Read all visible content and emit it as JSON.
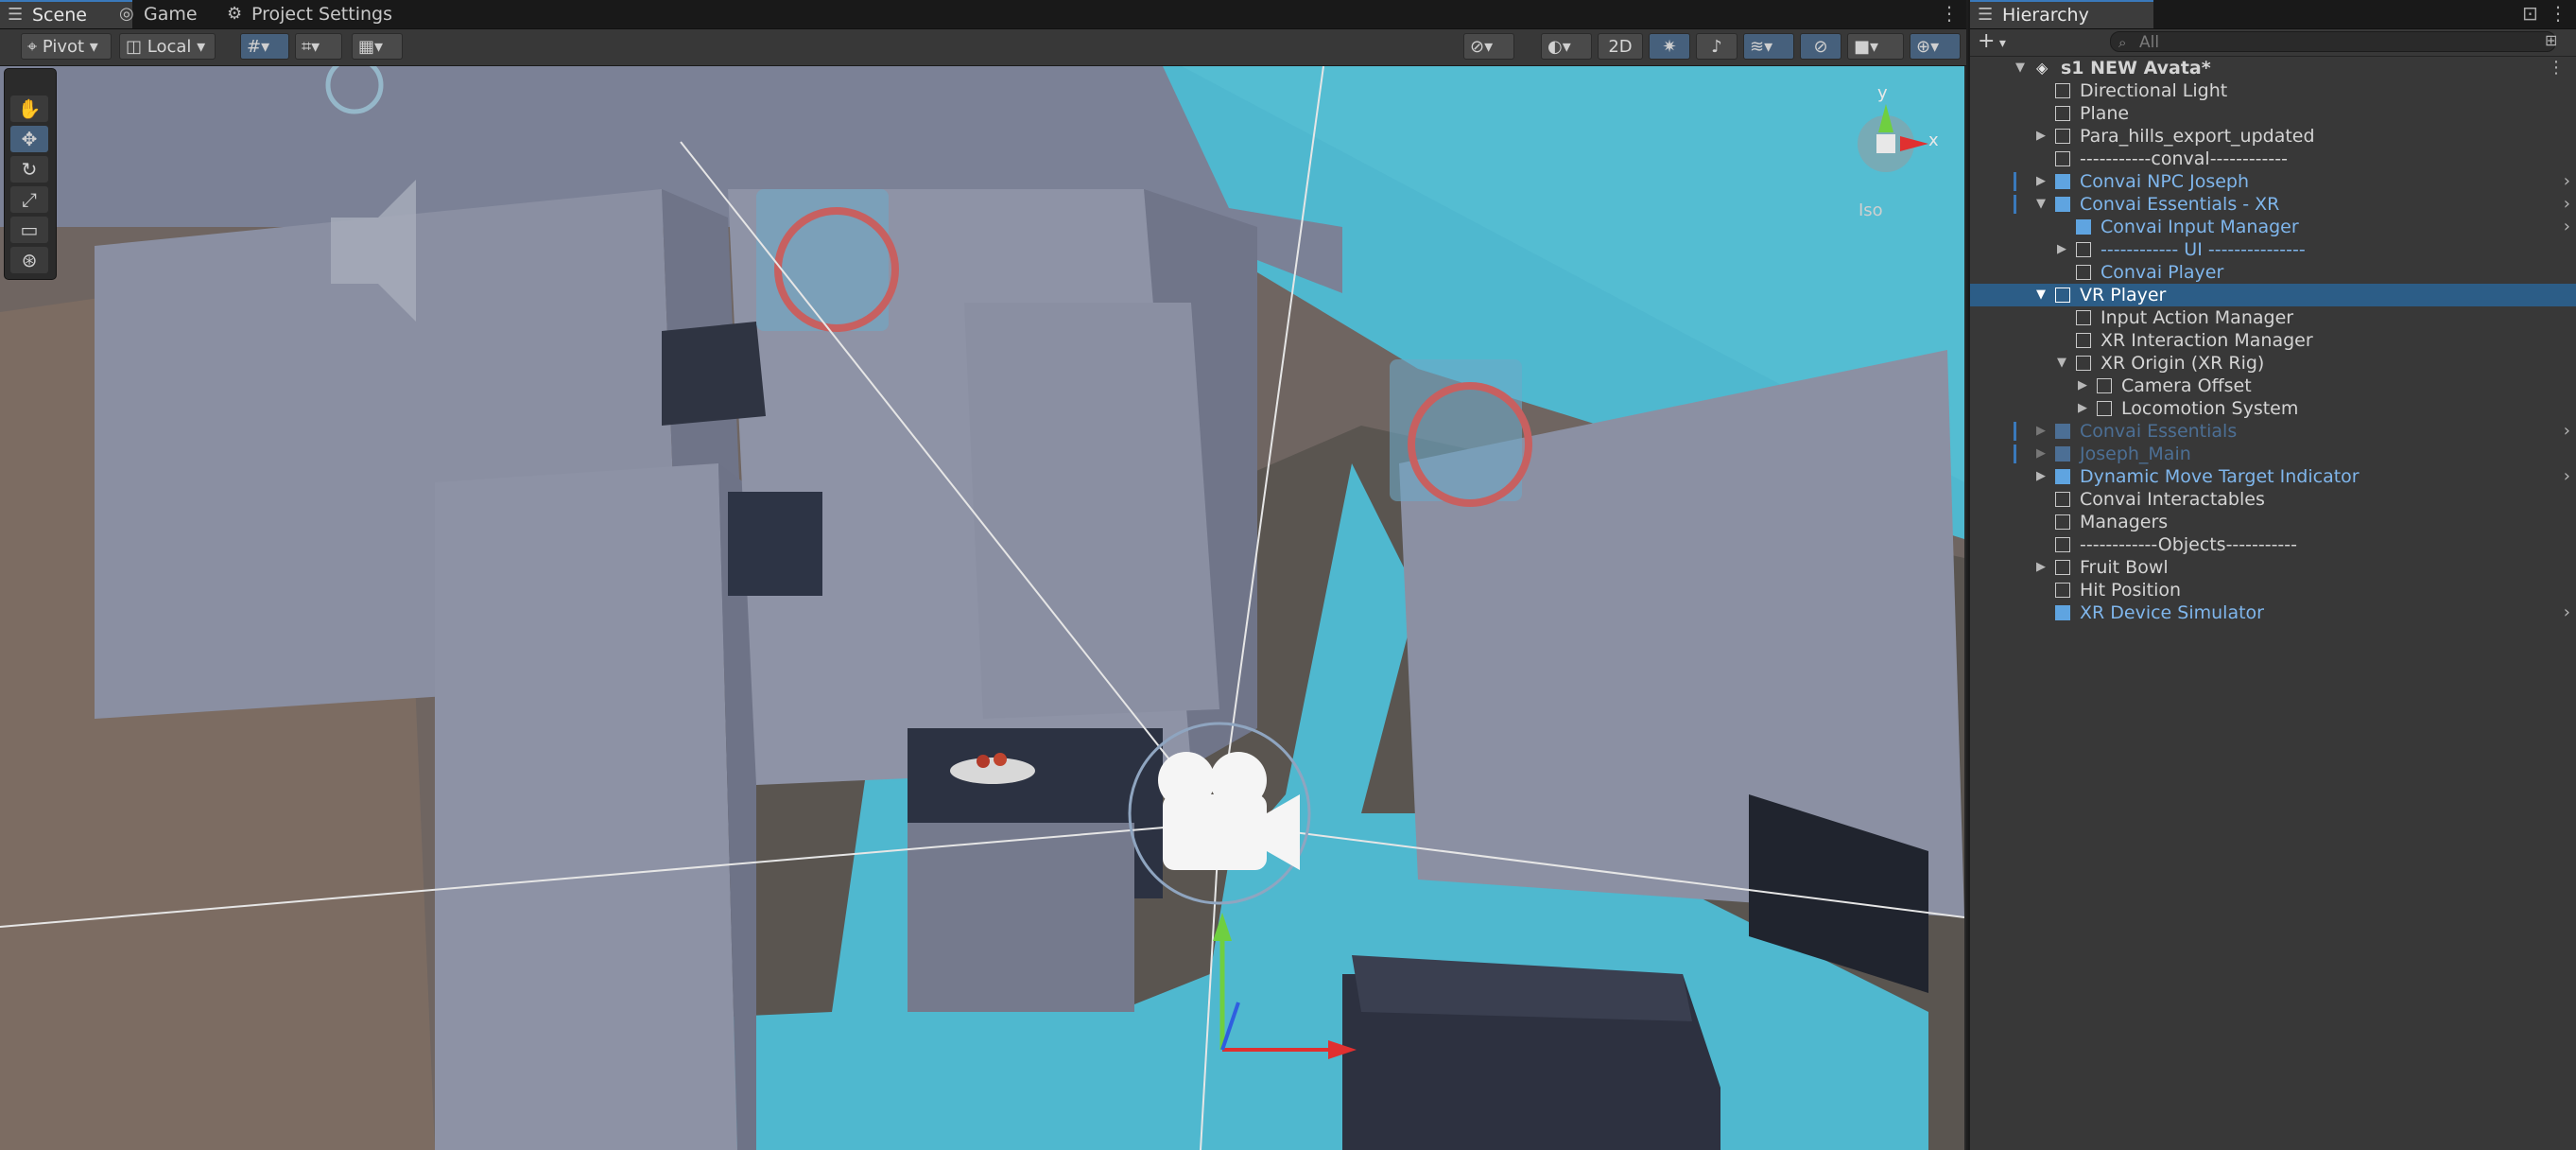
{
  "scene": {
    "tabs": [
      {
        "label": "Scene",
        "icon": "grid-icon"
      },
      {
        "label": "Game",
        "icon": "gamepad-icon"
      },
      {
        "label": "Project Settings",
        "icon": "gear-icon"
      }
    ],
    "toolbar": {
      "pivot_label": "Pivot",
      "local_label": "Local",
      "mode_2d_label": "2D"
    },
    "gizmo": {
      "y_label": "y",
      "x_label": "x",
      "projection_label": "Iso"
    }
  },
  "hierarchy": {
    "tab_label": "Hierarchy",
    "search_placeholder": "All",
    "add_label": "+",
    "items": [
      {
        "label": "s1 NEW Avata*"
      },
      {
        "label": "Directional Light"
      },
      {
        "label": "Plane"
      },
      {
        "label": "Para_hills_export_updated"
      },
      {
        "label": "-----------conval------------"
      },
      {
        "label": "Convai NPC Joseph"
      },
      {
        "label": "Convai Essentials - XR"
      },
      {
        "label": "Convai Input Manager"
      },
      {
        "label": "------------ UI ---------------"
      },
      {
        "label": "Convai Player"
      },
      {
        "label": "VR Player"
      },
      {
        "label": "Input Action Manager"
      },
      {
        "label": "XR Interaction Manager"
      },
      {
        "label": "XR Origin (XR Rig)"
      },
      {
        "label": "Camera Offset"
      },
      {
        "label": "Locomotion System"
      },
      {
        "label": "Convai Essentials"
      },
      {
        "label": "Joseph_Main"
      },
      {
        "label": "Dynamic Move Target Indicator"
      },
      {
        "label": "Convai Interactables"
      },
      {
        "label": "Managers"
      },
      {
        "label": "------------Objects-----------"
      },
      {
        "label": "Fruit Bowl"
      },
      {
        "label": "Hit Position"
      },
      {
        "label": "XR Device Simulator"
      }
    ]
  },
  "colors": {
    "accent": "#3a79bb",
    "selection": "#2c5d87",
    "prefab_text": "#7fb6ec",
    "floor_highlight": "#4fb8cf"
  }
}
